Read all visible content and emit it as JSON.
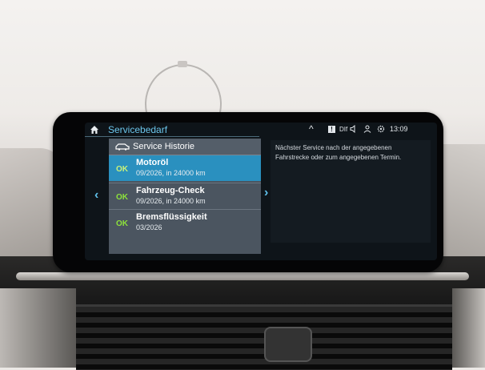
{
  "statusbar": {
    "title": "Servicebedarf",
    "info_badge": "!",
    "dlf_label": "DIf",
    "clock": "13:09"
  },
  "colors": {
    "accent": "#6cc6ec",
    "selected_row": "#2a90bf",
    "ok_green": "#8de23b",
    "panel_bg": "#4b5560"
  },
  "icons": {
    "home": "home-icon",
    "caret": "caret-up-icon",
    "info": "info-icon",
    "speaker": "speaker-icon",
    "person": "person-icon",
    "settings": "settings-icon",
    "car": "car-icon",
    "nav_left": "chevron-left-icon",
    "nav_right": "chevron-right-icon"
  },
  "nav": {
    "left_glyph": "‹",
    "right_glyph": "›",
    "caret_glyph": "^"
  },
  "panel": {
    "title": "Service Historie",
    "items": [
      {
        "status": "OK",
        "name": "Motoröl",
        "detail": "09/2026, in 24000 km",
        "selected": true
      },
      {
        "status": "OK",
        "name": "Fahrzeug-Check",
        "detail": "09/2026, in 24000 km",
        "selected": false
      },
      {
        "status": "OK",
        "name": "Bremsflüssigkeit",
        "detail": "03/2026",
        "selected": false
      }
    ]
  },
  "info": {
    "text": "Nächster Service nach der angegebenen Fahrstrecke oder zum angegebenen Termin."
  }
}
